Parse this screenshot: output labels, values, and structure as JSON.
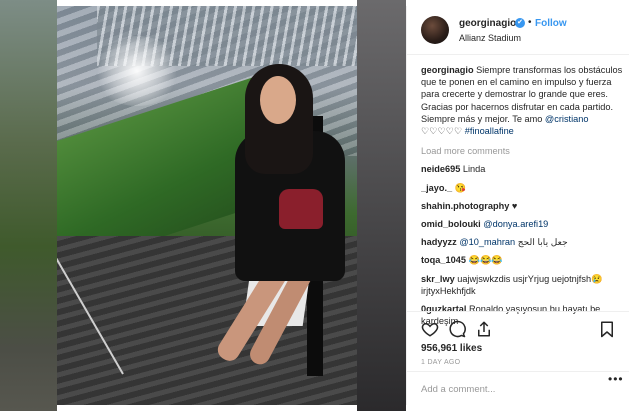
{
  "post": {
    "username": "georginagio",
    "verified_mark": "✔",
    "follow_label": "Follow",
    "location": "Allianz Stadium",
    "caption_user": "georginagio",
    "caption_text": "Siempre transformas los obstáculos que te ponen en el camino en impulso y fuerza para crecerte y demostrar lo grande que eres. Gracias por hacernos disfrutar en cada partido. Siempre más y mejor. Te amo",
    "caption_mention": "@cristiano",
    "caption_hearts": "♡♡♡♡♡",
    "caption_hashtag": "#finoallafine",
    "load_more": "Load more comments",
    "likes": "956,961 likes",
    "time_ago": "1 DAY AGO",
    "add_comment_placeholder": "Add a comment...",
    "more_options": "•••"
  },
  "comments": [
    {
      "user": "neide695",
      "text": "Linda"
    },
    {
      "user": "_jayo._",
      "text": "😘"
    },
    {
      "user": "shahin.photography",
      "text": "♥"
    },
    {
      "user": "omid_bolouki",
      "mention": "@donya.arefi19"
    },
    {
      "user": "hadyyzz",
      "mention": "@10_mahran",
      "text": "جعل يابا الحج"
    },
    {
      "user": "toqa_1045",
      "text": "😂😂😂"
    },
    {
      "user": "skr_lwy",
      "text": "uajwjswkzdis usjrYrjug uejotnjfsh😢 irjtyxHekhfjdk"
    },
    {
      "user": "0guzkartal",
      "text": "Ronaldo yaşıyosun bu hayatı be kardeşim"
    }
  ],
  "icons": {
    "like": "heart-icon",
    "comment": "comment-icon",
    "share": "share-icon",
    "save": "bookmark-icon"
  },
  "colors": {
    "accent": "#3897f0",
    "link": "#003569",
    "muted": "#999999"
  }
}
